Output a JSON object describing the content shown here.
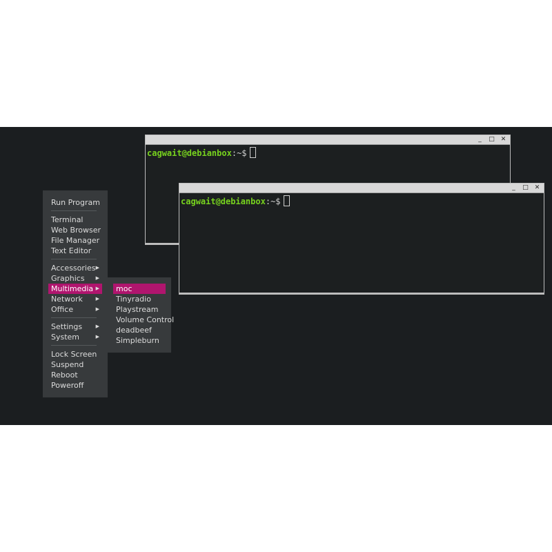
{
  "terminals": [
    {
      "user_host": "cagwait@debianbox",
      "colon": ":",
      "path": "~$"
    },
    {
      "user_host": "cagwait@debianbox",
      "colon": ":",
      "path": "~$"
    }
  ],
  "window_buttons": {
    "minimize": "_",
    "maximize": "□",
    "close": "✕"
  },
  "main_menu": {
    "groups": [
      [
        {
          "label": "Run Program"
        }
      ],
      [
        {
          "label": "Terminal"
        },
        {
          "label": "Web Browser"
        },
        {
          "label": "File Manager"
        },
        {
          "label": "Text Editor"
        }
      ],
      [
        {
          "label": "Accessories",
          "submenu": true
        },
        {
          "label": "Graphics",
          "submenu": true
        },
        {
          "label": "Multimedia",
          "submenu": true,
          "active": true
        },
        {
          "label": "Network",
          "submenu": true
        },
        {
          "label": "Office",
          "submenu": true
        }
      ],
      [
        {
          "label": "Settings",
          "submenu": true
        },
        {
          "label": "System",
          "submenu": true
        }
      ],
      [
        {
          "label": "Lock Screen"
        },
        {
          "label": "Suspend"
        },
        {
          "label": "Reboot"
        },
        {
          "label": "Poweroff"
        }
      ]
    ],
    "arrow_glyph": "▶"
  },
  "multimedia_submenu": {
    "items": [
      {
        "label": "moc",
        "active": true
      },
      {
        "label": "Tinyradio"
      },
      {
        "label": "Playstream"
      },
      {
        "label": "Volume Control"
      },
      {
        "label": "deadbeef"
      },
      {
        "label": "Simpleburn"
      }
    ]
  },
  "colors": {
    "accent": "#b0156e",
    "prompt_green": "#77d21e",
    "desktop": "#1b1e20",
    "menu_bg": "#373a3c"
  }
}
